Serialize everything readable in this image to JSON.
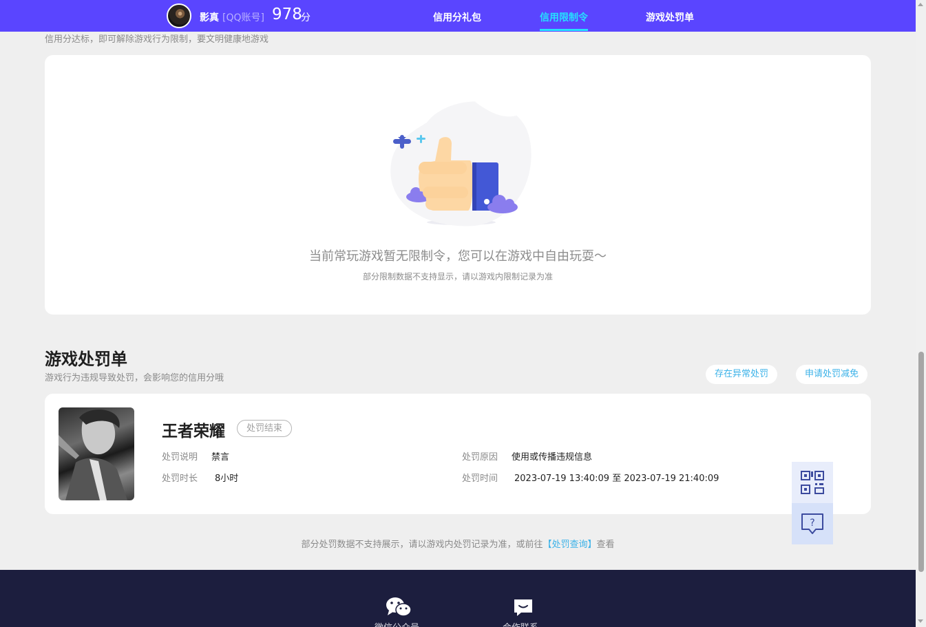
{
  "header": {
    "user_name": "影真",
    "account_type": "[QQ账号]",
    "score": "978",
    "score_unit": "分",
    "nav": [
      {
        "label": "信用分礼包",
        "active": false
      },
      {
        "label": "信用限制令",
        "active": true
      },
      {
        "label": "游戏处罚单",
        "active": false
      }
    ],
    "accent_color": "#5a45ff",
    "active_color": "#25e0ff"
  },
  "restriction": {
    "subtitle": "信用分达标，即可解除游戏行为限制，要文明健康地游戏",
    "empty_message": "当前常玩游戏暂无限制令，您可以在游戏中自由玩耍～",
    "empty_note": "部分限制数据不支持显示，请以游戏内限制记录为准"
  },
  "penalty": {
    "title": "游戏处罚单",
    "subtitle": "游戏行为违规导致处罚，会影响您的信用分哦",
    "actions": [
      "存在异常处罚",
      "申请处罚减免"
    ],
    "record": {
      "game_name": "王者荣耀",
      "status": "处罚结束",
      "desc_label": "处罚说明",
      "desc_value": "禁言",
      "duration_label": "处罚时长",
      "duration_value": "8小时",
      "reason_label": "处罚原因",
      "reason_value": "使用或传播违规信息",
      "time_label": "处罚时间",
      "time_value": "2023-07-19 13:40:09 至 2023-07-19 21:40:09"
    },
    "footnote_prefix": "部分处罚数据不支持展示，请以游戏内处罚记录为准，或前往",
    "footnote_link": "【处罚查询】",
    "footnote_suffix": "查看"
  },
  "floating": {
    "qr_icon": "qr-code-icon",
    "help_icon": "help-chat-icon"
  },
  "footer": {
    "items": [
      {
        "label": "微信公众号",
        "icon": "wechat-icon"
      },
      {
        "label": "合作联系",
        "icon": "message-icon"
      }
    ]
  }
}
